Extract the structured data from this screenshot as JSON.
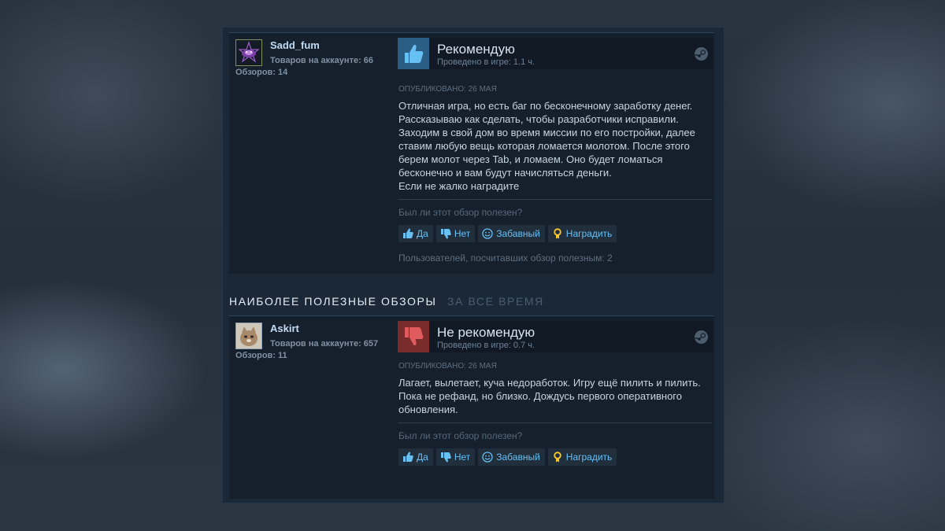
{
  "section": {
    "title": "НАИБОЛЕЕ ПОЛЕЗНЫЕ ОБЗОРЫ",
    "subtitle": "ЗА ВСЕ ВРЕМЯ"
  },
  "reviews": [
    {
      "username": "Sadd_fum",
      "products": "Товаров на аккаунте: 66",
      "review_count": "Обзоров: 14",
      "verdict": "Рекомендую",
      "verdict_type": "thumbs-up",
      "hours": "Проведено в игре: 1.1 ч.",
      "posted": "ОПУБЛИКОВАНО: 26 МАЯ",
      "text_lines": [
        "Отличная игра, но есть баг по бесконечному заработку денег.",
        "Рассказываю как сделать, чтобы разработчики исправили.",
        "Заходим в свой дом во время миссии по его постройки, далее",
        "ставим любую вещь которая ломается молотом. После этого",
        "берем молот через Tab, и ломаем. Оно будет ломаться",
        "бесконечно и вам будут начисляться деньги.",
        "Если не жалко наградите"
      ],
      "helpful_question": "Был ли этот обзор полезен?",
      "buttons": {
        "yes": "Да",
        "no": "Нет",
        "funny": "Забавный",
        "award": "Наградить"
      },
      "found_helpful": "Пользователей, посчитавших обзор полезным: 2"
    },
    {
      "username": "Askirt",
      "products": "Товаров на аккаунте: 657",
      "review_count": "Обзоров: 11",
      "verdict": "Не рекомендую",
      "verdict_type": "thumbs-down",
      "hours": "Проведено в игре: 0.7 ч.",
      "posted": "ОПУБЛИКОВАНО: 26 МАЯ",
      "text_lines": [
        "Лагает, вылетает, куча недоработок. Игру ещё пилить и пилить.",
        "Пока не рефанд, но близко. Дождусь первого оперативного",
        "обновления."
      ],
      "helpful_question": "Был ли этот обзор полезен?",
      "buttons": {
        "yes": "Да",
        "no": "Нет",
        "funny": "Забавный",
        "award": "Наградить"
      }
    }
  ],
  "colors": {
    "panel_bg": "#1b2838",
    "review_bg": "#16202d",
    "link_blue": "#67c1f5",
    "thumb_up_bg": "#2b5e84",
    "thumb_down_bg": "#7a2b2b",
    "award_gold": "#ffc82c"
  },
  "icons": [
    "thumbs-up-icon",
    "thumbs-down-icon",
    "steam-icon",
    "smiley-icon",
    "award-icon"
  ]
}
